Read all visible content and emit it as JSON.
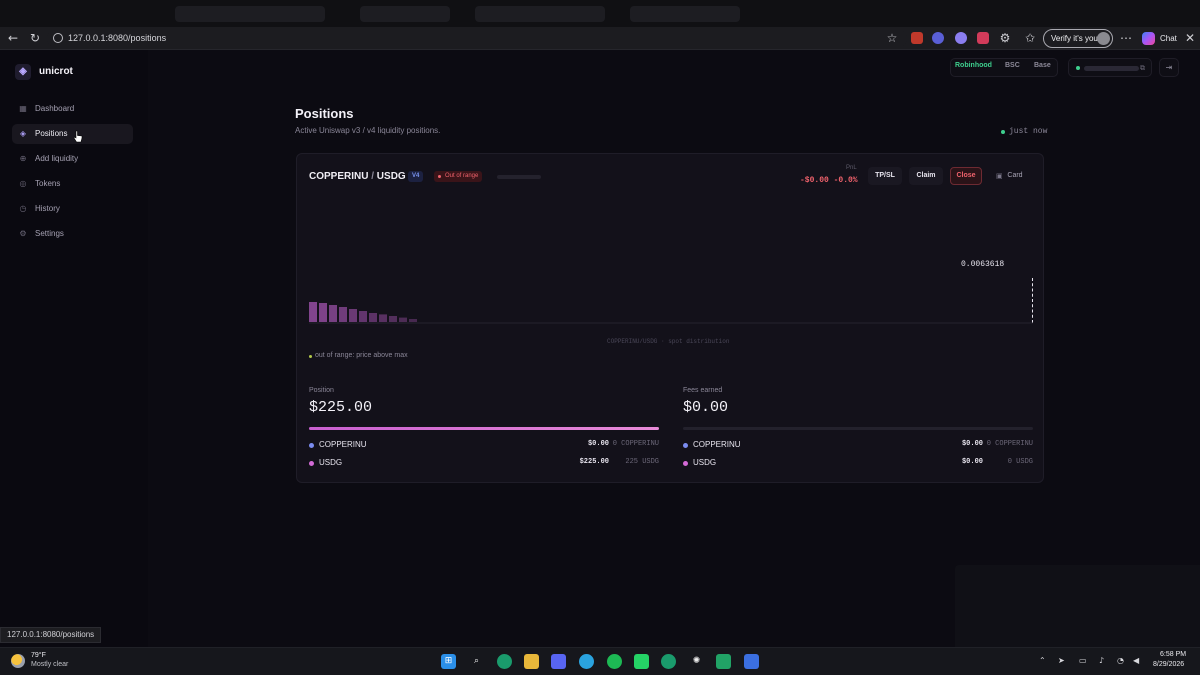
{
  "browser": {
    "url": "127.0.0.1:8080/positions",
    "verify_label": "Verify it's you",
    "chat_label": "Chat",
    "status_url": "127.0.0.1:8080/positions"
  },
  "app": {
    "brand": "unicrot",
    "nav": [
      {
        "label": "Dashboard",
        "icon": "grid-icon"
      },
      {
        "label": "Positions",
        "icon": "layers-icon",
        "active": true
      },
      {
        "label": "Add liquidity",
        "icon": "plus-circle-icon"
      },
      {
        "label": "Tokens",
        "icon": "coins-icon"
      },
      {
        "label": "History",
        "icon": "clock-icon"
      },
      {
        "label": "Settings",
        "icon": "gear-icon"
      }
    ],
    "chains": [
      "Robinhood",
      "BSC",
      "Base"
    ],
    "active_chain": "Robinhood",
    "accent_green": "#3ecf8e",
    "accent_red": "#f0626c"
  },
  "page": {
    "title": "Positions",
    "subtitle": "Active Uniswap v3 / v4 liquidity positions.",
    "updated": "just now"
  },
  "position": {
    "token0": "COPPERINU",
    "separator": "/",
    "token1": "USDG",
    "version": "V4",
    "range_status": "Out of range",
    "pnl_label": "PnL",
    "pnl_value": "-$0.00 -0.0%",
    "actions": {
      "tpsl": "TP/SL",
      "claim": "Claim",
      "close": "Close",
      "card": "Card"
    },
    "current_price": "0.0063618",
    "chart_caption": "COPPERINU/USDG · spot distribution",
    "range_note": "out of range: price above max",
    "position_label": "Position",
    "position_value": "$225.00",
    "position_fill_pct": 100,
    "fees_label": "Fees earned",
    "fees_value": "$0.00",
    "fees_fill_pct": 0,
    "holdings": [
      {
        "token": "COPPERINU",
        "usd": "$0.00",
        "amount": "0 COPPERINU",
        "color": "#7b8cf0"
      },
      {
        "token": "USDG",
        "usd": "$225.00",
        "amount": "225 USDG",
        "color": "#d36ad6"
      }
    ],
    "fees": [
      {
        "token": "COPPERINU",
        "usd": "$0.00",
        "amount": "0 COPPERINU",
        "color": "#7b8cf0"
      },
      {
        "token": "USDG",
        "usd": "$0.00",
        "amount": "0 USDG",
        "color": "#d36ad6"
      }
    ],
    "liquidity_bars": [
      1.0,
      0.95,
      0.85,
      0.75,
      0.65,
      0.55,
      0.45,
      0.38,
      0.3,
      0.22,
      0.15
    ]
  },
  "taskbar": {
    "temp": "79°F",
    "condition": "Mostly clear",
    "time": "6:58 PM",
    "date": "8/29/2026"
  }
}
